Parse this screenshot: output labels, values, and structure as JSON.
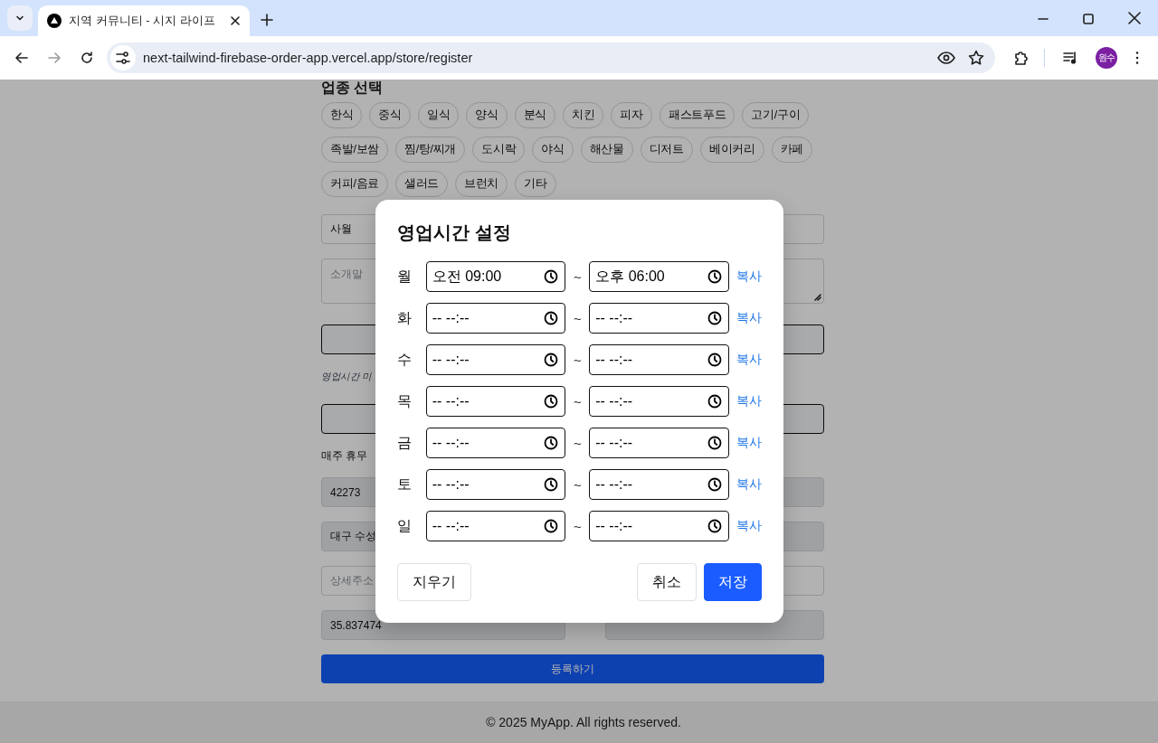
{
  "browser": {
    "tabs": [
      {
        "title": "지역 커뮤니티 - 시지 라이프",
        "selected": true
      }
    ],
    "nav_buttons": [
      {
        "kind": "back",
        "disabled": false
      },
      {
        "kind": "forward",
        "disabled": true
      },
      {
        "kind": "reload",
        "disabled": false
      }
    ],
    "address": "next-tailwind-firebase-order-app.vercel.app/store/register",
    "profile": "원수"
  },
  "page": {
    "category_heading": "업종 선택",
    "categories": [
      "한식",
      "중식",
      "일식",
      "양식",
      "분식",
      "치킨",
      "피자",
      "패스트푸드",
      "고기/구이",
      "족발/보쌈",
      "찜/탕/찌개",
      "도시락",
      "야식",
      "해산물",
      "디저트",
      "베이커리",
      "카페",
      "커피/음료",
      "샐러드",
      "브런치",
      "기타"
    ],
    "form": [
      {
        "kind": "input",
        "value": "사월",
        "filled": false
      },
      {
        "kind": "textarea",
        "placeholder": "소개말"
      },
      {
        "kind": "button"
      },
      {
        "kind": "note",
        "text": "영업시간 미"
      },
      {
        "kind": "button"
      },
      {
        "kind": "label",
        "text": "매주 휴무"
      },
      {
        "kind": "input",
        "value": "42273",
        "filled": true
      },
      {
        "kind": "input",
        "value": "대구 수성",
        "filled": true
      },
      {
        "kind": "input",
        "placeholder": "상세주소",
        "filled": false
      },
      {
        "kind": "pair",
        "items": [
          {
            "value": "35.837474",
            "filled": true
          },
          {
            "filled": true
          }
        ]
      },
      {
        "kind": "submit",
        "label": "등록하기"
      }
    ],
    "footer": "© 2025 MyApp. All rights reserved."
  },
  "modal": {
    "title": "영업시간 설정",
    "days": [
      {
        "day": "월",
        "open": "오전 09:00",
        "close": "오후 06:00",
        "copy": "복사"
      },
      {
        "day": "화",
        "open": "-- --:--",
        "close": "-- --:--",
        "copy": "복사"
      },
      {
        "day": "수",
        "open": "-- --:--",
        "close": "-- --:--",
        "copy": "복사"
      },
      {
        "day": "목",
        "open": "-- --:--",
        "close": "-- --:--",
        "copy": "복사"
      },
      {
        "day": "금",
        "open": "-- --:--",
        "close": "-- --:--",
        "copy": "복사"
      },
      {
        "day": "토",
        "open": "-- --:--",
        "close": "-- --:--",
        "copy": "복사"
      },
      {
        "day": "일",
        "open": "-- --:--",
        "close": "-- --:--",
        "copy": "복사"
      }
    ],
    "separator": "~",
    "buttons": [
      {
        "kind": "clear",
        "label": "지우기"
      },
      {
        "kind": "cancel",
        "label": "취소"
      },
      {
        "kind": "save",
        "label": "저장"
      }
    ]
  }
}
